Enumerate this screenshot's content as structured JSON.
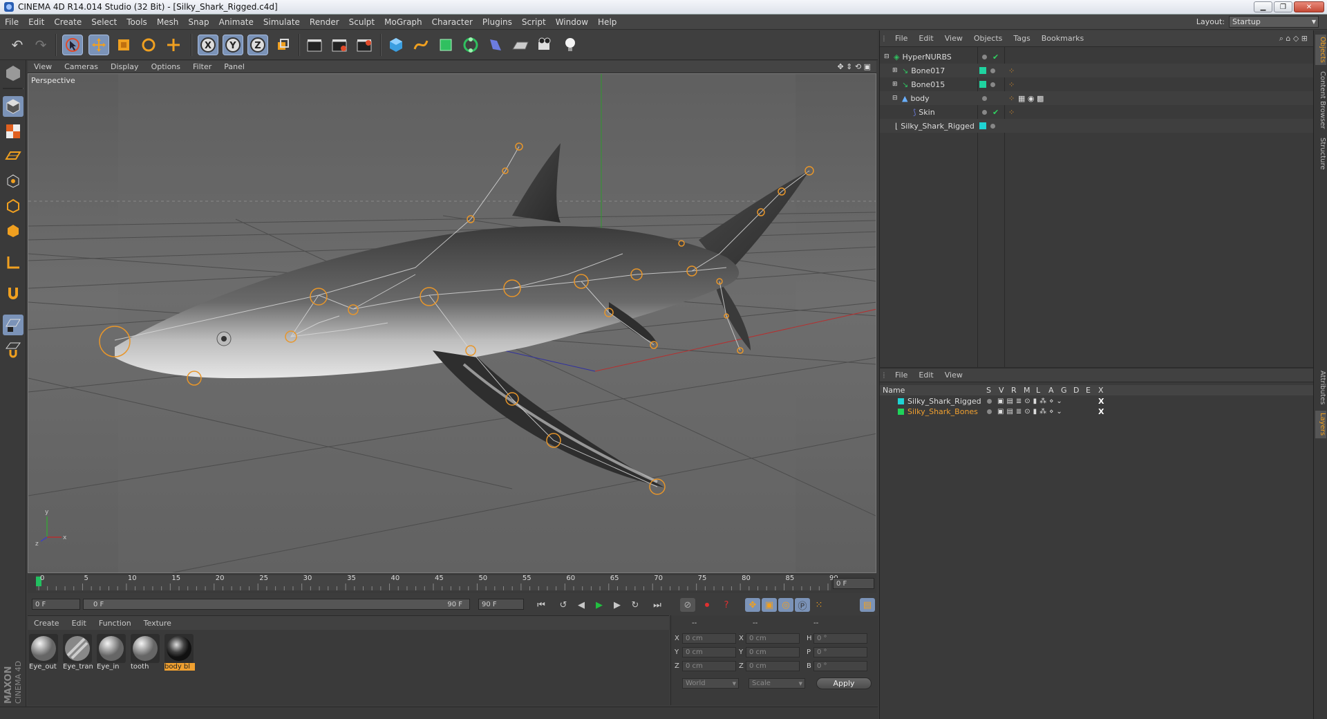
{
  "window": {
    "title": "CINEMA 4D R14.014 Studio (32 Bit) - [Silky_Shark_Rigged.c4d]"
  },
  "menu": [
    "File",
    "Edit",
    "Create",
    "Select",
    "Tools",
    "Mesh",
    "Snap",
    "Animate",
    "Simulate",
    "Render",
    "Sculpt",
    "MoGraph",
    "Character",
    "Plugins",
    "Script",
    "Window",
    "Help"
  ],
  "layout": {
    "label": "Layout:",
    "value": "Startup"
  },
  "viewport": {
    "menu": [
      "View",
      "Cameras",
      "Display",
      "Options",
      "Filter",
      "Panel"
    ],
    "label": "Perspective"
  },
  "timeline": {
    "ticks": [
      "0",
      "5",
      "10",
      "15",
      "20",
      "25",
      "30",
      "35",
      "40",
      "45",
      "50",
      "55",
      "60",
      "65",
      "70",
      "75",
      "80",
      "85",
      "90"
    ],
    "current_frame": "0 F",
    "start": "0 F",
    "range_start": "0 F",
    "range_end": "90 F",
    "end": "90 F"
  },
  "materials": {
    "menu": [
      "Create",
      "Edit",
      "Function",
      "Texture"
    ],
    "items": [
      {
        "name": "Eye_out",
        "selected": false
      },
      {
        "name": "Eye_tran",
        "selected": false
      },
      {
        "name": "Eye_in",
        "selected": false
      },
      {
        "name": "tooth",
        "selected": false
      },
      {
        "name": "body bl",
        "selected": true
      }
    ]
  },
  "coordinates": {
    "headers": [
      "--",
      "--",
      "--"
    ],
    "rows": [
      {
        "axis": "X",
        "pos": "0 cm",
        "axis2": "X",
        "size": "0 cm",
        "rot_axis": "H",
        "rot": "0 °"
      },
      {
        "axis": "Y",
        "pos": "0 cm",
        "axis2": "Y",
        "size": "0 cm",
        "rot_axis": "P",
        "rot": "0 °"
      },
      {
        "axis": "Z",
        "pos": "0 cm",
        "axis2": "Z",
        "size": "0 cm",
        "rot_axis": "B",
        "rot": "0 °"
      }
    ],
    "world": "World",
    "scale": "Scale",
    "apply": "Apply"
  },
  "objects": {
    "menu": [
      "File",
      "Edit",
      "View",
      "Objects",
      "Tags",
      "Bookmarks"
    ],
    "rows": [
      {
        "name": "HyperNURBS",
        "indent": 0,
        "color": ""
      },
      {
        "name": "Bone017",
        "indent": 1,
        "color": "#1fd3a0"
      },
      {
        "name": "Bone015",
        "indent": 1,
        "color": "#1fd3a0"
      },
      {
        "name": "body",
        "indent": 1,
        "color": ""
      },
      {
        "name": "Skin",
        "indent": 2,
        "color": ""
      },
      {
        "name": "Silky_Shark_Rigged",
        "indent": 0,
        "color": "#1fd3d3"
      }
    ]
  },
  "layers": {
    "menu": [
      "File",
      "Edit",
      "View"
    ],
    "columns": [
      "Name",
      "S",
      "V",
      "R",
      "M",
      "L",
      "A",
      "G",
      "D",
      "E",
      "X"
    ],
    "rows": [
      {
        "name": "Silky_Shark_Rigged",
        "color": "#1fd3d3"
      },
      {
        "name": "Silky_Shark_Bones",
        "color": "#1fd35a"
      }
    ]
  },
  "side_tabs": [
    "Objects",
    "Content Browser",
    "Structure",
    "Attributes",
    "Layers"
  ],
  "brand": {
    "line1": "MAXON",
    "line2": "CINEMA 4D"
  },
  "colors": {
    "accent": "#7b93b8",
    "selected_layer": "#f0a030",
    "bone_joint": "#e8962a"
  }
}
